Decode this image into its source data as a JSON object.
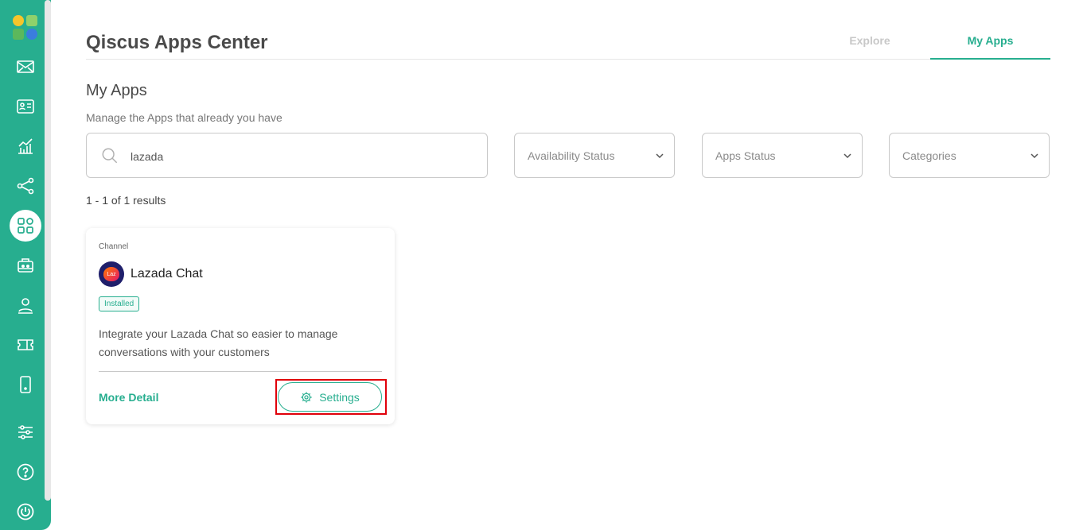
{
  "app": {
    "title": "Qiscus Apps Center"
  },
  "tabs": [
    {
      "label": "Explore",
      "active": false
    },
    {
      "label": "My Apps",
      "active": true
    }
  ],
  "section": {
    "title": "My Apps",
    "subtitle": "Manage the Apps that already you have"
  },
  "search": {
    "value": "lazada",
    "placeholder": ""
  },
  "filters": [
    {
      "label": "Availability Status"
    },
    {
      "label": "Apps Status"
    },
    {
      "label": "Categories"
    }
  ],
  "results_text": "1 - 1 of 1 results",
  "card": {
    "category": "Channel",
    "logo_text": "Laz",
    "name": "Lazada Chat",
    "badge": "Installed",
    "description": "Integrate your Lazada Chat so easier to manage conversations with your customers",
    "more_detail_label": "More Detail",
    "settings_label": "Settings"
  },
  "sidebar": {
    "items": [
      {
        "icon": "mail-icon"
      },
      {
        "icon": "contact-card-icon"
      },
      {
        "icon": "analytics-icon"
      },
      {
        "icon": "integration-icon"
      },
      {
        "icon": "apps-grid-icon",
        "active": true
      },
      {
        "icon": "bot-icon"
      },
      {
        "icon": "agent-icon"
      },
      {
        "icon": "ticket-icon"
      },
      {
        "icon": "mobile-icon"
      },
      {
        "icon": "settings-sliders-icon"
      },
      {
        "icon": "help-icon"
      },
      {
        "icon": "power-icon"
      }
    ]
  },
  "colors": {
    "accent": "#27ae8f",
    "sidebar": "#27ae8f",
    "highlight": "#e0000a"
  }
}
